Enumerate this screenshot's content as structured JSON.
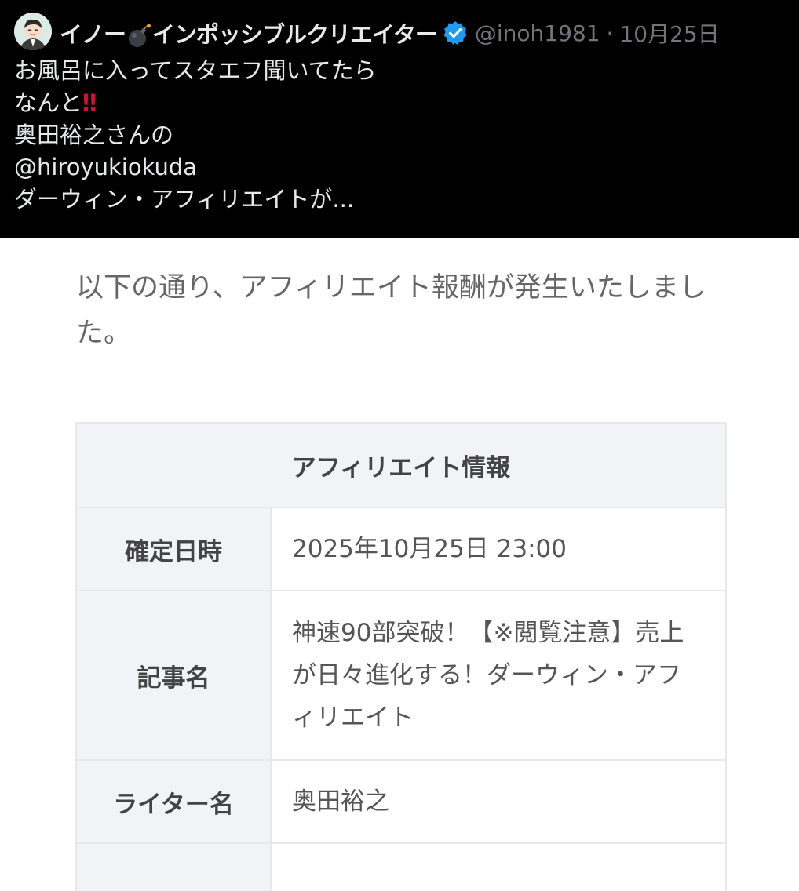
{
  "tweet": {
    "author_name_part1": "イノー",
    "author_name_part2": "インポッシブルクリエイター",
    "handle": "@inoh1981",
    "separator": "·",
    "date": "10月25日",
    "lines": [
      "お風呂に入ってスタエフ聞いてたら",
      "なんと",
      "奥田裕之さんの",
      "@hiroyukiokuda",
      "ダーウィン・アフィリエイトが..."
    ],
    "emoji": "‼",
    "icons": {
      "avatar": "avatar-illustration",
      "bomb": "bomb-emoji-icon",
      "verified": "verified-badge-icon"
    },
    "colors": {
      "background": "#000000",
      "verified": "#1d9bf0",
      "muted": "#71767b"
    }
  },
  "screenshot": {
    "intro_text": "以下の通り、アフィリエイト報酬が発生いたしました。",
    "table": {
      "title": "アフィリエイト情報",
      "rows": [
        {
          "label": "確定日時",
          "value": "2025年10月25日 23:00"
        },
        {
          "label": "記事名",
          "value": "神速90部突破！【※閲覧注意】売上が日々進化する！ダーウィン・アフィリエイト"
        },
        {
          "label": "ライター名",
          "value": "奥田裕之"
        }
      ]
    }
  }
}
